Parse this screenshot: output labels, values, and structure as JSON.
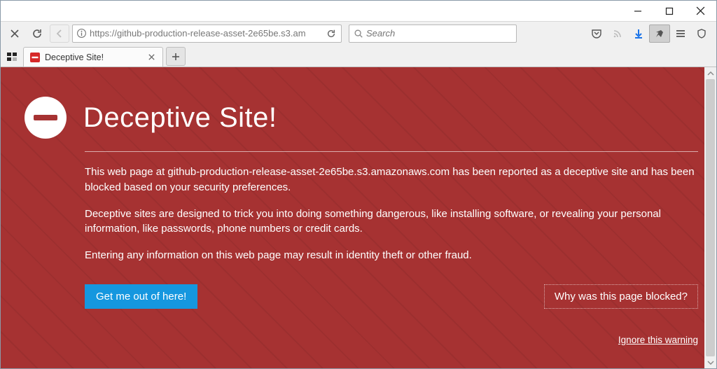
{
  "window": {
    "url": "https://github-production-release-asset-2e65be.s3.am",
    "search_placeholder": "Search",
    "tab_title": "Deceptive Site!"
  },
  "warning": {
    "heading": "Deceptive Site!",
    "para1": "This web page at github-production-release-asset-2e65be.s3.amazonaws.com has been reported as a deceptive site and has been blocked based on your security preferences.",
    "para2": "Deceptive sites are designed to trick you into doing something dangerous, like installing software, or revealing your personal information, like passwords, phone numbers or credit cards.",
    "para3": "Entering any information on this web page may result in identity theft or other fraud.",
    "primary_button": "Get me out of here!",
    "secondary_button": "Why was this page blocked?",
    "ignore_link": "Ignore this warning"
  },
  "colors": {
    "danger_bg": "#a63232",
    "primary_btn": "#1597df"
  }
}
